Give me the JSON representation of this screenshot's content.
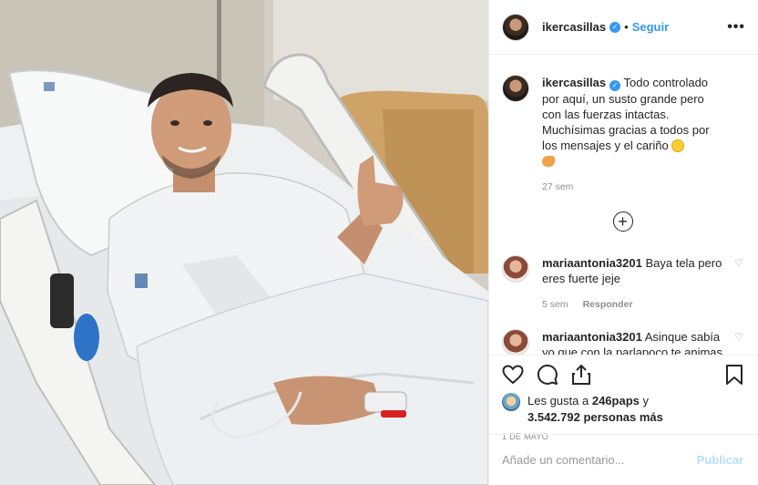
{
  "post": {
    "username": "ikercasillas",
    "follow_label": "Seguir",
    "dot": "•",
    "more_label": "•••"
  },
  "caption": {
    "username": "ikercasillas",
    "text": "Todo controlado por aquí, un susto grande pero con las fuerzas intactas. Muchísimas gracias a todos por los mensajes y el cariño",
    "time": "27 sem"
  },
  "comments": [
    {
      "username": "mariaantonia3201",
      "text": "Baya tela pero eres fuerte jeje",
      "time": "5 sem",
      "reply_label": "Responder"
    },
    {
      "username": "mariaantonia3201",
      "text": "Asinque sabía yo que con la parlapoco te animas jajajaja"
    }
  ],
  "likes": {
    "prefix": "Les gusta a",
    "user": "246paps",
    "conj": "y",
    "count": "3.542.792 personas más"
  },
  "date": "1 DE MAYO",
  "add_comment": {
    "placeholder": "Añade un comentario...",
    "publish_label": "Publicar"
  },
  "icons": {
    "heart": "heart-icon",
    "comment": "comment-icon",
    "share": "share-icon",
    "bookmark": "bookmark-icon",
    "verified": "verified-badge-icon",
    "plus": "plus-circle-icon"
  },
  "colors": {
    "link_blue": "#3897f0",
    "verified_blue": "#3897f0",
    "publish_disabled": "#b2dffc",
    "muted": "#8e8e8e"
  }
}
